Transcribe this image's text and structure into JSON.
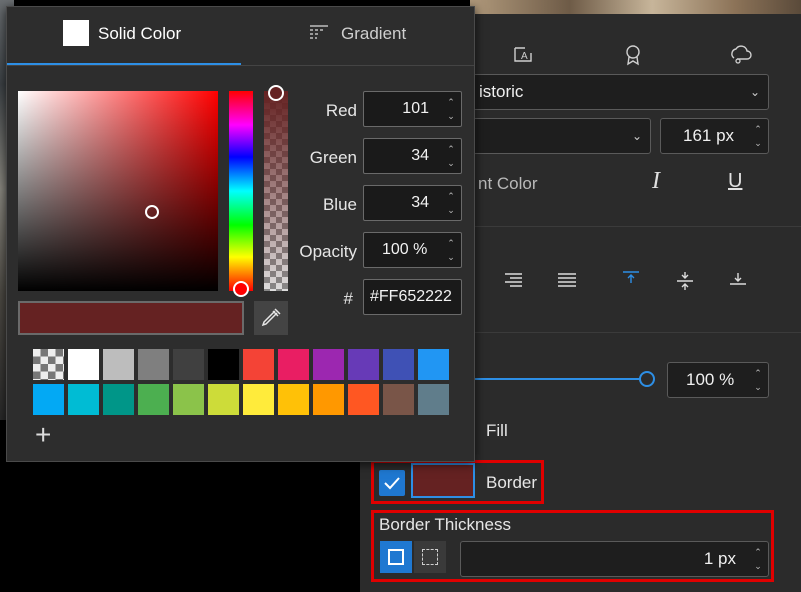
{
  "picker": {
    "tabs": [
      {
        "label": "Solid Color",
        "active": true
      },
      {
        "label": "Gradient",
        "active": false
      }
    ],
    "channels": [
      {
        "label": "Red",
        "value": "101"
      },
      {
        "label": "Green",
        "value": "34"
      },
      {
        "label": "Blue",
        "value": "34"
      },
      {
        "label": "Opacity",
        "value": "100 %"
      }
    ],
    "hex_label": "#",
    "hex_value": "#FF652222",
    "current_color": "#652222",
    "swatches_row1": [
      "checker",
      "#ffffff",
      "#bdbdbd",
      "#7f7f7f",
      "#404040",
      "#000000",
      "#f44336",
      "#e91e63",
      "#9c27b0",
      "#673ab7",
      "#3f51b5",
      "#2196f3"
    ],
    "swatches_row2": [
      "#03a9f4",
      "#00bcd4",
      "#009688",
      "#4caf50",
      "#8bc34a",
      "#cddc39",
      "#ffeb3b",
      "#ffc107",
      "#ff9800",
      "#ff5722",
      "#795548",
      "#607d8b"
    ],
    "add_label": "+"
  },
  "panel": {
    "font_value": "istoric",
    "size_value": "161 px",
    "font_color_label": "nt Color",
    "italic_label": "I",
    "underline_label": "U",
    "opacity_value": "100 %",
    "opacity_level": 1.0,
    "fill_label": "Fill",
    "border_label": "Border",
    "border_color": "#652222",
    "border_thickness_label": "Border Thickness",
    "thickness_value": "1 px"
  }
}
